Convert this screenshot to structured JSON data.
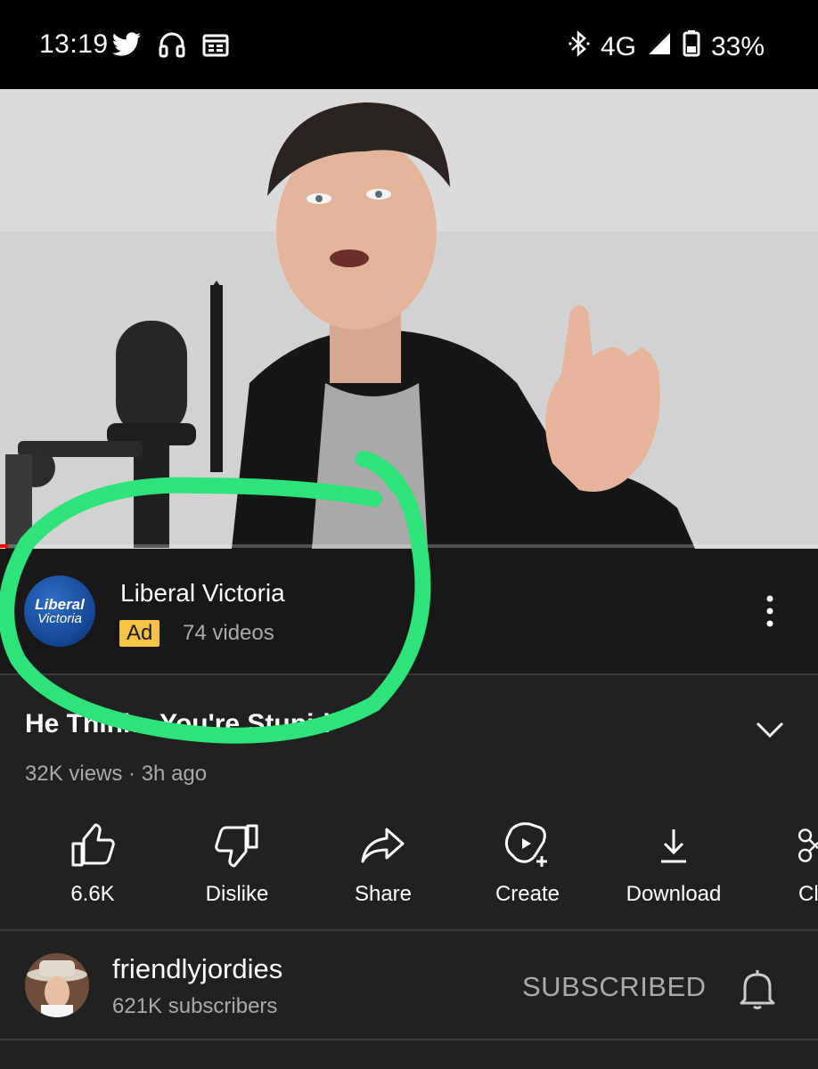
{
  "status_bar": {
    "time": "13:19",
    "network": "4G",
    "battery": "33%",
    "icons": [
      "twitter-icon",
      "headphones-icon",
      "calendar-icon",
      "bluetooth-icon",
      "signal-icon",
      "battery-icon"
    ]
  },
  "video": {
    "progress_fraction": 0.01,
    "progress_color": "#ff0000"
  },
  "ad": {
    "channel_name": "Liberal Victoria",
    "avatar_line1": "Liberal",
    "avatar_line2": "Victoria",
    "badge": "Ad",
    "videos": "74 videos",
    "badge_color": "#f6c343"
  },
  "video_info": {
    "title": "He Thinks You're Stupid",
    "meta": "32K views · 3h ago"
  },
  "actions": [
    {
      "icon": "thumbs-up-icon",
      "label": "6.6K"
    },
    {
      "icon": "thumbs-down-icon",
      "label": "Dislike"
    },
    {
      "icon": "share-icon",
      "label": "Share"
    },
    {
      "icon": "create-icon",
      "label": "Create"
    },
    {
      "icon": "download-icon",
      "label": "Download"
    },
    {
      "icon": "clip-icon",
      "label": "Cl"
    }
  ],
  "channel": {
    "name": "friendlyjordies",
    "subscribers": "621K subscribers",
    "subscribe_label": "SUBSCRIBED"
  },
  "annotation_color": "#2de37a"
}
